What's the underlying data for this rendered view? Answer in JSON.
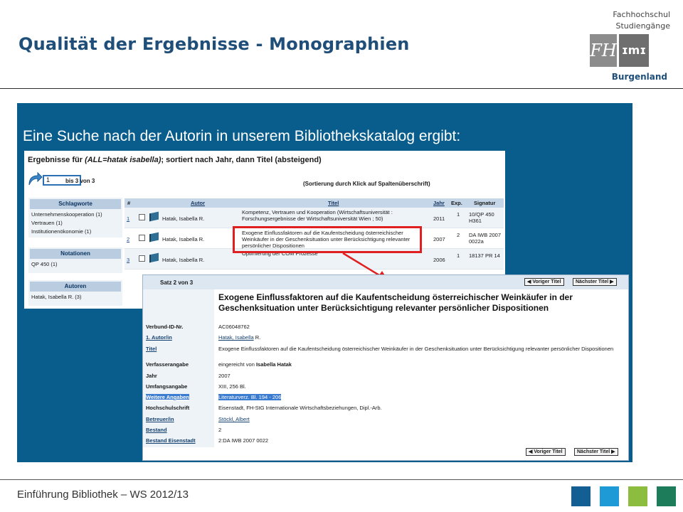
{
  "slide": {
    "title": "Qualität der Ergebnisse - Monographien",
    "caption": "Eine Suche nach der Autorin in unserem Bibliothekskatalog ergibt:",
    "footer": "Einführung Bibliothek – WS 2012/13",
    "footer_colors": [
      "#135f94",
      "#1e9ad6",
      "#8cbd3f",
      "#1d7d5a"
    ]
  },
  "logo": {
    "line1": "Fachhochschul",
    "line2": "Studiengänge",
    "mark_left": "FH",
    "mark_right": "ɪmɪ",
    "line3": "Burgenland"
  },
  "results": {
    "title_prefix": "Ergebnisse für ",
    "title_query": "(ALL=hatak isabella)",
    "title_suffix": "; sortiert nach Jahr, dann Titel (absteigend)",
    "page_value": "1",
    "page_info": "bis 3 von 3",
    "sort_hint": "(Sortierung durch Klick auf Spaltenüberschrift)",
    "facets": [
      {
        "header": "Schlagworte",
        "items": [
          "Unternehmenskooperation (1)",
          "Vertrauen (1)",
          "Institutionenökonomie (1)"
        ]
      },
      {
        "header": "Notationen",
        "items": [
          "QP 450 (1)"
        ]
      },
      {
        "header": "Autoren",
        "items": [
          "Hatak, Isabella R. (3)"
        ]
      }
    ],
    "columns": {
      "num": "#",
      "autor": "Autor",
      "titel": "Titel",
      "jahr": "Jahr",
      "exp": "Exp.",
      "signatur": "Signatur"
    },
    "rows": [
      {
        "num": "1",
        "autor": "Hatak, Isabella R.",
        "titel": "Kompetenz, Vertrauen und Kooperation (Wirtschaftsuniversität : Forschungsergebnisse der Wirtschaftsuniversität Wien ; 50)",
        "jahr": "2011",
        "exp": "1",
        "signatur": "10/QP 450 H361"
      },
      {
        "num": "2",
        "autor": "Hatak, Isabella R.",
        "titel": "Exogene Einflussfaktoren auf die Kaufentscheidung österreichischer Weinkäufer in der Geschenksituation unter Berücksichtigung relevanter persönlicher Dispositionen",
        "jahr": "2007",
        "exp": "2",
        "signatur": "DA IWB 2007 0022a"
      },
      {
        "num": "3",
        "autor": "Hatak, Isabella R.",
        "titel": "Optimierung der COM Prozesse",
        "jahr": "2006",
        "exp": "1",
        "signatur": "18137 PR 14"
      }
    ]
  },
  "detail": {
    "satz": "Satz 2 von 3",
    "prev_label": "◀ Voriger Titel",
    "next_label": "Nächster Titel ▶",
    "big_title": "Exogene Einflussfaktoren auf die Kaufentscheidung österreichischer Weinkäufer in der Geschenksituation unter Berücksichtigung relevanter persönlicher Dispositionen",
    "fields": {
      "verbund_label": "Verbund-ID-Nr.",
      "verbund_value": "AC06048762",
      "autor_label": "1. Autor/in",
      "autor_value": "Hatak, Isabella",
      "autor_value_rest": " R.",
      "titel_label": "Titel",
      "titel_value": "Exogene Einflussfaktoren auf die Kaufentscheidung österreichischer Weinkäufer in der Geschenksituation unter Berücksichtigung relevanter persönlicher Dispositionen",
      "verf_label": "Verfasserangabe",
      "verf_value_prefix": "eingereicht von ",
      "verf_value_name": "Isabella Hatak",
      "jahr_label": "Jahr",
      "jahr_value": "2007",
      "umfang_label": "Umfangsangabe",
      "umfang_value": "XIII, 256 Bl.",
      "weitere_label": "Weitere Angaben",
      "weitere_value": "Literaturverz. Bl. 194 - 206",
      "hochschul_label": "Hochschulschrift",
      "hochschul_value": "Eisenstadt, FH-StG Internationale Wirtschaftsbeziehungen, Dipl.-Arb.",
      "betreuer_label": "Betreuer/in",
      "betreuer_value": "Stöckl, Albert",
      "bestand_label": "Bestand",
      "bestand_value": "2",
      "bestand_e_label": "Bestand Eisenstadt",
      "bestand_e_value": "2:DA IWB 2007 0022"
    }
  }
}
